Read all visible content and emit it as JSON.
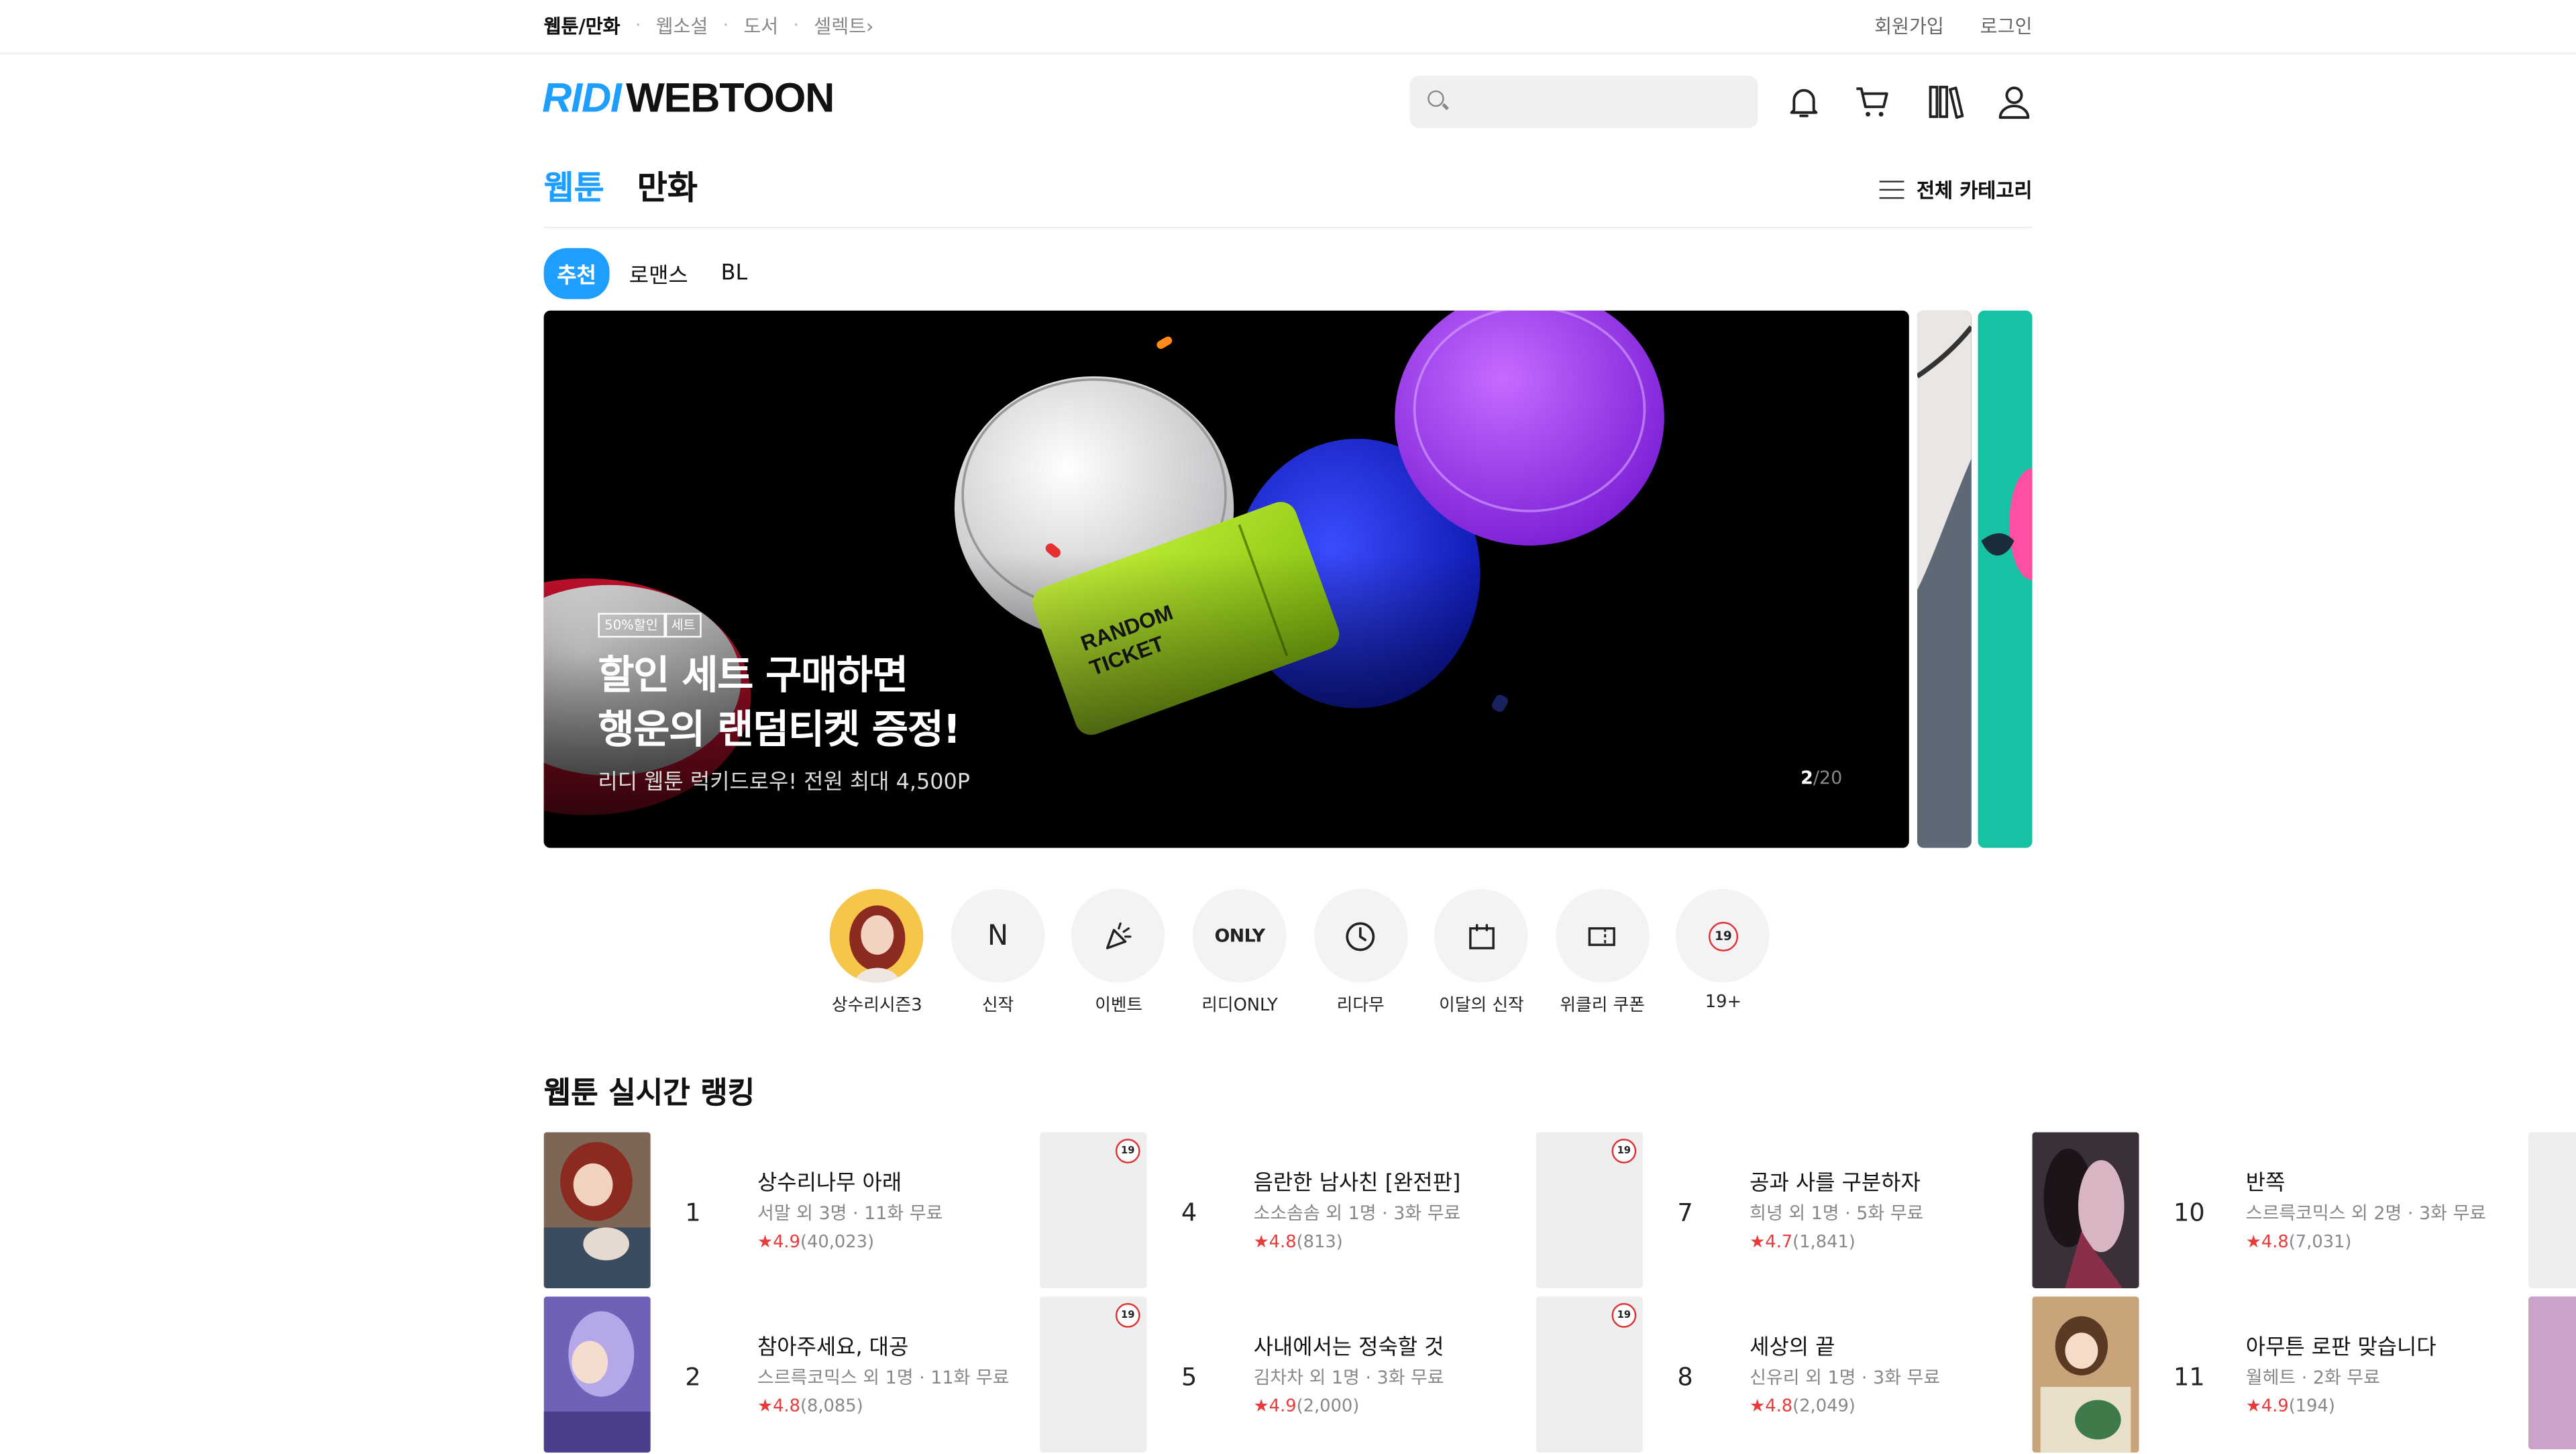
{
  "topnav": {
    "items": [
      "웹툰/만화",
      "웹소설",
      "도서",
      "셀렉트"
    ],
    "active": "웹툰/만화",
    "select_arrow": "›"
  },
  "auth": {
    "signup": "회원가입",
    "login": "로그인"
  },
  "logo": {
    "ridi": "RIDI",
    "webtoon": "WEBTOON"
  },
  "search": {
    "placeholder": ""
  },
  "header_icons": [
    "bell-icon",
    "cart-icon",
    "library-icon",
    "user-icon"
  ],
  "main_tabs": [
    {
      "label": "웹툰",
      "active": true
    },
    {
      "label": "만화",
      "active": false
    }
  ],
  "all_categories": "전체 카테고리",
  "genre_chips": [
    {
      "label": "추천",
      "active": true
    },
    {
      "label": "로맨스",
      "active": false
    },
    {
      "label": "BL",
      "active": false
    }
  ],
  "banner": {
    "badges": [
      "50%할인",
      "세트"
    ],
    "title": "할인 세트 구매하면\n행운의 랜덤티켓 증정!",
    "subtitle": "리디 웹툰 럭키드로우! 전원 최대 4,500P",
    "page_current": "2",
    "page_total": "/20",
    "art_text": "RANDOM TICKET"
  },
  "quick_menu": [
    {
      "label": "상수리시즌3",
      "icon": "avatar-image"
    },
    {
      "label": "신작",
      "icon": "N"
    },
    {
      "label": "이벤트",
      "icon": "party-popper-icon"
    },
    {
      "label": "리디ONLY",
      "icon": "ONLY"
    },
    {
      "label": "리다무",
      "icon": "clock-icon"
    },
    {
      "label": "이달의 신작",
      "icon": "calendar-icon"
    },
    {
      "label": "위클리 쿠폰",
      "icon": "coupon-icon"
    },
    {
      "label": "19+",
      "icon": "19"
    }
  ],
  "ranking": {
    "title": "웹툰 실시간 랭킹",
    "items": [
      {
        "rank": "1",
        "title": "상수리나무 아래",
        "meta": "서말 외 3명 · 11화 무료",
        "rating": "4.9",
        "count": "(40,023)",
        "adult": false,
        "cover": "#8a6b5a"
      },
      {
        "rank": "2",
        "title": "참아주세요, 대공",
        "meta": "스르륵코믹스 외 1명 · 11화 무료",
        "rating": "4.8",
        "count": "(8,085)",
        "adult": false,
        "cover": "#6e62b8"
      },
      {
        "rank": "4",
        "title": "음란한 남사친 [완전판]",
        "meta": "소소솜솜 외 1명 · 3화 무료",
        "rating": "4.8",
        "count": "(813)",
        "adult": true,
        "cover": ""
      },
      {
        "rank": "5",
        "title": "사내에서는 정숙할 것",
        "meta": "김차차 외 1명 · 3화 무료",
        "rating": "4.9",
        "count": "(2,000)",
        "adult": true,
        "cover": ""
      },
      {
        "rank": "7",
        "title": "공과 사를 구분하자",
        "meta": "희녕 외 1명 · 5화 무료",
        "rating": "4.7",
        "count": "(1,841)",
        "adult": true,
        "cover": ""
      },
      {
        "rank": "8",
        "title": "세상의 끝",
        "meta": "신유리 외 1명 · 3화 무료",
        "rating": "4.8",
        "count": "(2,049)",
        "adult": true,
        "cover": ""
      },
      {
        "rank": "10",
        "title": "반쪽",
        "meta": "스르륵코믹스 외 2명 · 3화 무료",
        "rating": "4.8",
        "count": "(7,031)",
        "adult": false,
        "cover": "#3b2f3a"
      },
      {
        "rank": "11",
        "title": "아무튼 로판 맞습니다",
        "meta": "월헤트 · 2화 무료",
        "rating": "4.9",
        "count": "(194)",
        "adult": false,
        "cover": "#c9a37a"
      }
    ]
  },
  "colors": {
    "accent": "#1e9eff",
    "star": "#e83a3a"
  }
}
